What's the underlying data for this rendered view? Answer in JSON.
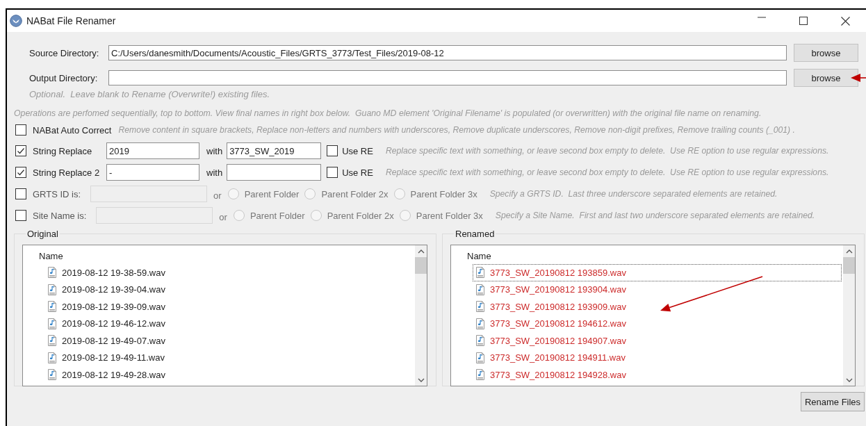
{
  "window": {
    "title": "NABat File Renamer"
  },
  "directories": [
    {
      "label": "Source Directory:",
      "value": "C:/Users/danesmith/Documents/Acoustic_Files/GRTS_3773/Test_Files/2019-08-12",
      "button": "browse"
    },
    {
      "label": "Output Directory:",
      "button": "browse"
    }
  ],
  "output_hint": "Optional.  Leave blank to Rename (Overwrite!) existing files.",
  "operations_note": "Operations are perfomed sequentially, top to bottom. View final names in right box below.  Guano MD element 'Original Filename' is populated (or overwritten) with the original file name on renaming.",
  "operations": [
    {
      "kind": "auto",
      "label": "NABat Auto Correct",
      "checked": false,
      "description": "Remove content in square brackets, Replace non-letters and numbers with underscores, Remove duplicate underscores, Remove non-digit prefixes, Remove trailing counts (_001) ."
    },
    {
      "kind": "replace",
      "label": "String Replace",
      "checked": true,
      "find": "2019",
      "with_label": "with",
      "replacement": "3773_SW_2019",
      "use_re": {
        "label": "Use RE",
        "checked": false
      },
      "description": "Replace specific text with something, or leave second box empty to delete.  Use RE option to use regular expressions."
    },
    {
      "kind": "replace",
      "label": "String Replace 2",
      "checked": true,
      "find": "-",
      "with_label": "with",
      "use_re": {
        "label": "Use RE",
        "checked": false
      },
      "description": "Replace specific text with something, or leave second box empty to delete.  Use RE option to use regular expressions."
    },
    {
      "kind": "folder",
      "label": "GRTS ID is:",
      "checked": false,
      "disabled": true,
      "or_label": "or",
      "options": [
        {
          "label": "Parent Folder",
          "selected": false
        },
        {
          "label": "Parent Folder 2x",
          "selected": false
        },
        {
          "label": "Parent Folder 3x",
          "selected": false
        }
      ],
      "description": "Specify a GRTS ID.  Last three underscore separated elements are retained."
    },
    {
      "kind": "folder",
      "label": "Site Name is:",
      "checked": false,
      "disabled": true,
      "or_label": "or",
      "options": [
        {
          "label": "Parent Folder",
          "selected": false
        },
        {
          "label": "Parent Folder 2x",
          "selected": false
        },
        {
          "label": "Parent Folder 3x",
          "selected": false
        }
      ],
      "description": "Specify a Site Name.  First and last two underscore separated elements are retained."
    }
  ],
  "panels": [
    {
      "title": "Original",
      "column": "Name",
      "renamed": false,
      "files": [
        {
          "name": "2019-08-12 19-38-59.wav",
          "selected": false
        },
        {
          "name": "2019-08-12 19-39-04.wav",
          "selected": false
        },
        {
          "name": "2019-08-12 19-39-09.wav",
          "selected": false
        },
        {
          "name": "2019-08-12 19-46-12.wav",
          "selected": false
        },
        {
          "name": "2019-08-12 19-49-07.wav",
          "selected": false
        },
        {
          "name": "2019-08-12 19-49-11.wav",
          "selected": false
        },
        {
          "name": "2019-08-12 19-49-28.wav",
          "selected": false
        }
      ]
    },
    {
      "title": "Renamed",
      "column": "Name",
      "renamed": true,
      "files": [
        {
          "name": "3773_SW_20190812 193859.wav",
          "selected": true
        },
        {
          "name": "3773_SW_20190812 193904.wav",
          "selected": false
        },
        {
          "name": "3773_SW_20190812 193909.wav",
          "selected": false
        },
        {
          "name": "3773_SW_20190812 194612.wav",
          "selected": false
        },
        {
          "name": "3773_SW_20190812 194907.wav",
          "selected": false
        },
        {
          "name": "3773_SW_20190812 194911.wav",
          "selected": false
        },
        {
          "name": "3773_SW_20190812 194928.wav",
          "selected": false
        }
      ]
    }
  ],
  "rename_button": "Rename Files",
  "annotations": [
    {
      "kind": "arrow"
    },
    {
      "kind": "arrow"
    }
  ]
}
